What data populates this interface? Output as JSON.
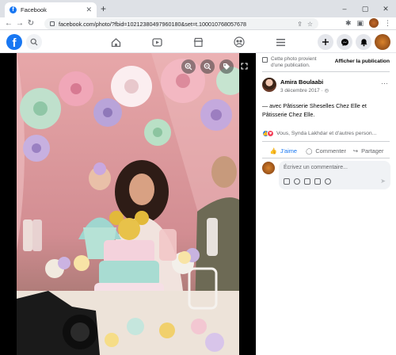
{
  "browser": {
    "tab_title": "Facebook",
    "tab_favicon": "f",
    "url": "facebook.com/photo/?fbid=10212380497960180&set=t.100010768057678",
    "controls": {
      "minimize": "–",
      "maximize": "▢",
      "close": "✕",
      "new_tab": "+",
      "tab_close": "✕"
    },
    "nav": {
      "back": "←",
      "forward": "→",
      "reload": "↻"
    }
  },
  "fb": {
    "logo": "f",
    "accent": "#1877f2"
  },
  "side": {
    "notice": "Cette photo provient d'une publication.",
    "notice_link": "Afficher la publication",
    "author": "Amira Boulaabi",
    "date": "3 décembre 2017 ·",
    "more": "···",
    "caption": "— avec Pâtisserie Sheselles Chez Elle et Pâtisserie Chez Elle.",
    "reactions_text": "Vous, Synda Lakhdar et d'autres person...",
    "actions": {
      "like": "J'aime",
      "comment": "Commenter",
      "share": "Partager"
    },
    "comment_placeholder": "Écrivez un commentaire..."
  }
}
